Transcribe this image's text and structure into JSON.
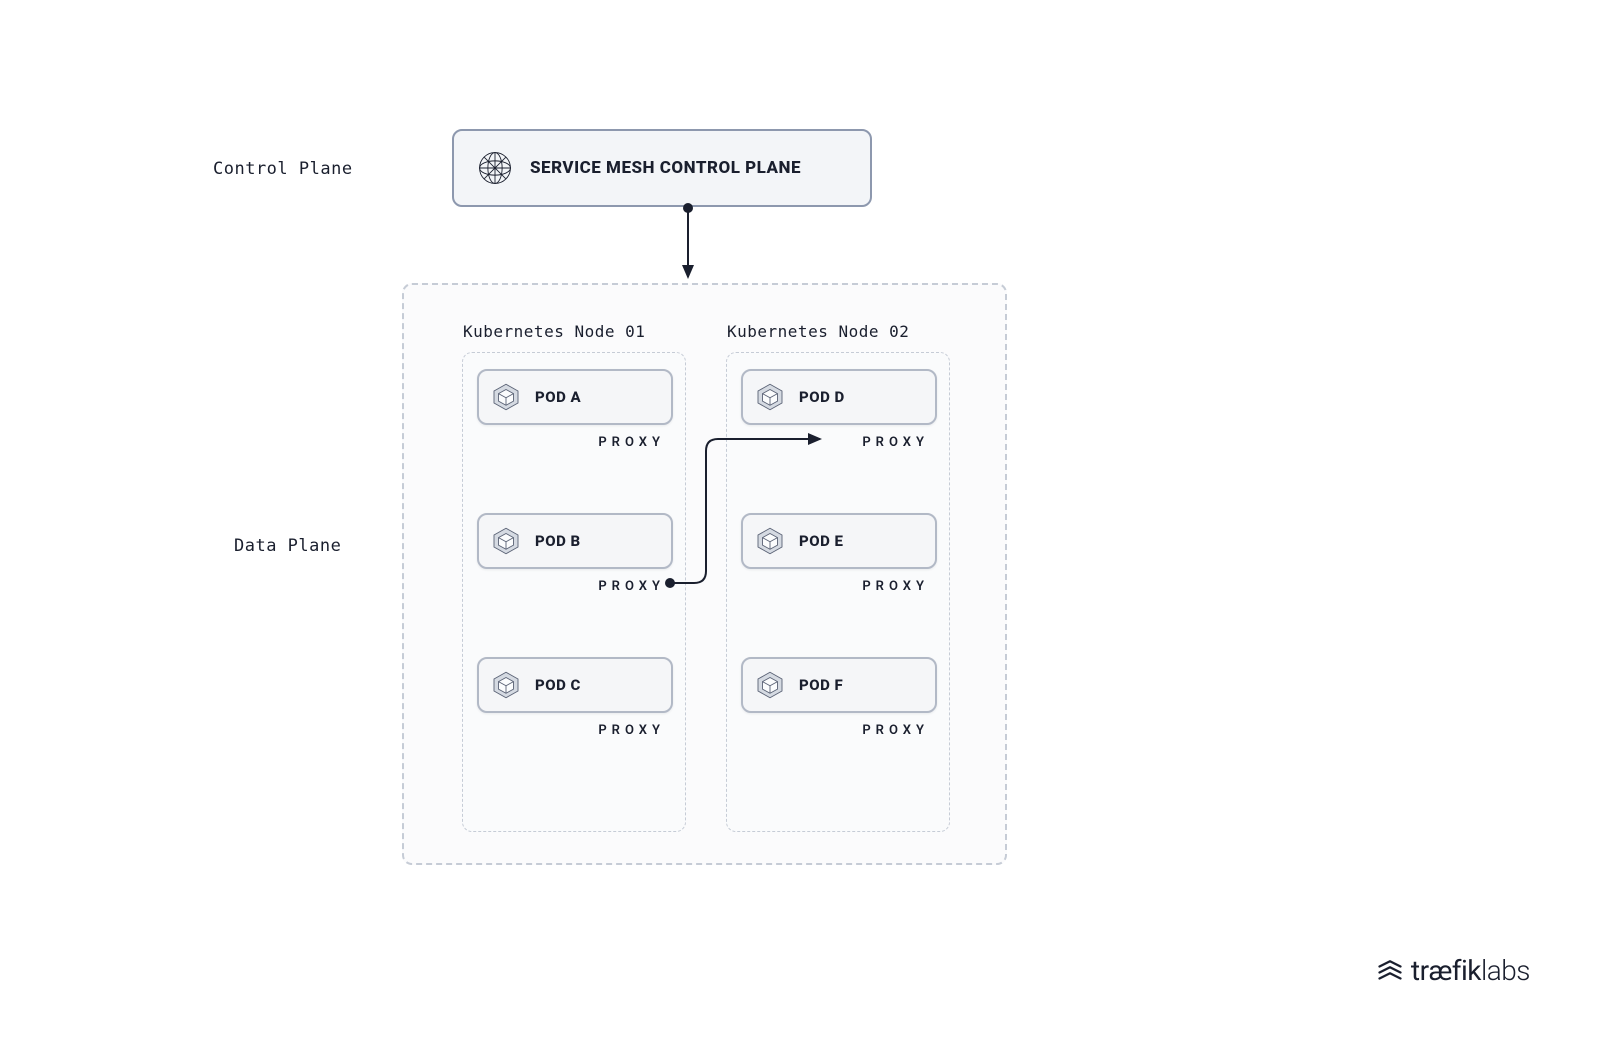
{
  "labels": {
    "control_plane": "Control Plane",
    "data_plane": "Data Plane"
  },
  "control_box": {
    "title": "SERVICE MESH CONTROL PLANE"
  },
  "nodes": [
    {
      "title": "Kubernetes Node 01",
      "pods": [
        {
          "name": "POD A",
          "proxy": "PROXY"
        },
        {
          "name": "POD B",
          "proxy": "PROXY"
        },
        {
          "name": "POD C",
          "proxy": "PROXY"
        }
      ]
    },
    {
      "title": "Kubernetes Node 02",
      "pods": [
        {
          "name": "POD D",
          "proxy": "PROXY"
        },
        {
          "name": "POD E",
          "proxy": "PROXY"
        },
        {
          "name": "POD F",
          "proxy": "PROXY"
        }
      ]
    }
  ],
  "proxy_label": "PROXY",
  "brand": {
    "text_prefix": "tr",
    "text_lig": "æ",
    "text_mid": "fik",
    "text_suffix": "labs"
  },
  "colors": {
    "stroke_dark": "#1a1f2e",
    "stroke_dashed": "#c6ccd6",
    "stroke_box": "#8d98ae",
    "box_bg": "#f3f5f8",
    "pod_border": "#b2b9c6",
    "page_bg": "#ffffff"
  }
}
